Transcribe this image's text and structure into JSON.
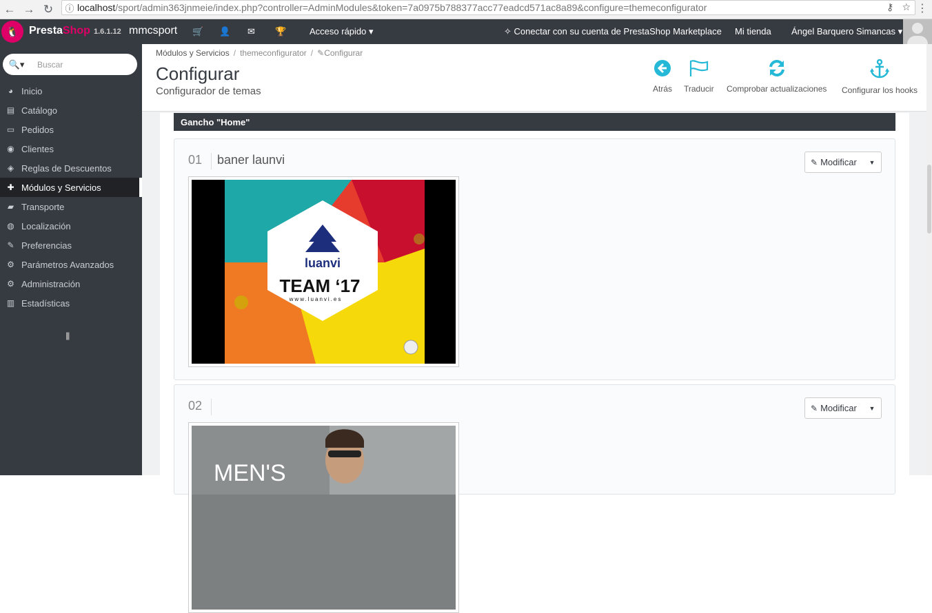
{
  "browser": {
    "host": "localhost",
    "url_rest": "/sport/admin363jnmeie/index.php?controller=AdminModules&token=7a0975b788377acc77eadcd571ac8a89&configure=themeconfigurator"
  },
  "header": {
    "brand_a": "Presta",
    "brand_b": "Shop",
    "version": "1.6.1.12",
    "shop_name": "mmcsport",
    "quick_access": "Acceso rápido ▾",
    "marketplace": "Conectar con su cuenta de PrestaShop Marketplace",
    "my_shop": "Mi tienda",
    "user": "Ángel Barquero Simancas ▾"
  },
  "sidebar": {
    "search_placeholder": "Buscar",
    "items": [
      {
        "label": "Inicio",
        "icon": "◕"
      },
      {
        "label": "Catálogo",
        "icon": "▤"
      },
      {
        "label": "Pedidos",
        "icon": "▭"
      },
      {
        "label": "Clientes",
        "icon": "◉"
      },
      {
        "label": "Reglas de Descuentos",
        "icon": "◈"
      },
      {
        "label": "Módulos y Servicios",
        "icon": "✚"
      },
      {
        "label": "Transporte",
        "icon": "▰"
      },
      {
        "label": "Localización",
        "icon": "◍"
      },
      {
        "label": "Preferencias",
        "icon": "✎"
      },
      {
        "label": "Parámetros Avanzados",
        "icon": "⚙"
      },
      {
        "label": "Administración",
        "icon": "⚙"
      },
      {
        "label": "Estadísticas",
        "icon": "▥"
      }
    ],
    "collapse": "||||"
  },
  "toolbar": {
    "breadcrumb": [
      "Módulos y Servicios",
      "themeconfigurator",
      "Configurar"
    ],
    "title": "Configurar",
    "subtitle": "Configurador de temas",
    "buttons": [
      {
        "label": "Atrás",
        "icon": "back-icon"
      },
      {
        "label": "Traducir",
        "icon": "flag-icon"
      },
      {
        "label": "Comprobar actualizaciones",
        "icon": "refresh-icon"
      },
      {
        "label": "Configurar los hooks",
        "icon": "anchor-icon"
      }
    ]
  },
  "panel": {
    "hook_title": "Gancho \"Home\"",
    "items": [
      {
        "num": "01",
        "title": "baner launvi",
        "button": "Modificar"
      },
      {
        "num": "02",
        "title": "",
        "button": "Modificar"
      }
    ],
    "banner1": {
      "brand": "luanvi",
      "team": "TEAM ‘17",
      "site": "www.luanvi.es"
    },
    "banner2": {
      "text": "MEN'S"
    }
  },
  "colors": {
    "accent": "#25b9d7",
    "dark": "#363a41",
    "brand": "#df0067"
  }
}
